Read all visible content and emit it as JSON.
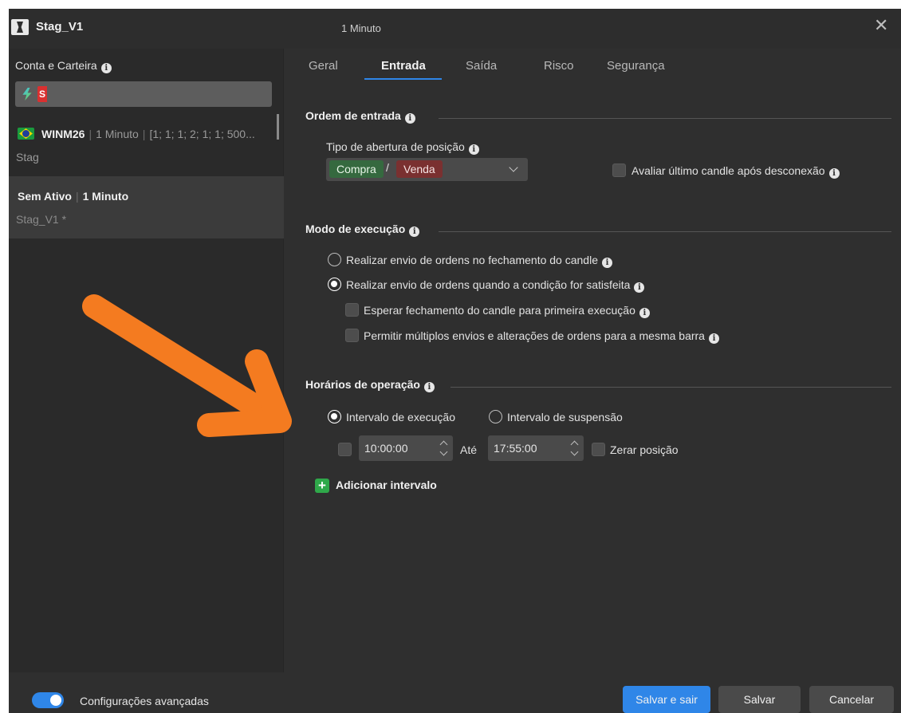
{
  "window": {
    "title": "Stag_V1",
    "subtitle": "1 Minuto",
    "close": "✕"
  },
  "sidebar": {
    "account_label": "Conta e Carteira",
    "strategies": [
      {
        "asset": "WINM26",
        "timeframe": "1 Minuto",
        "params": "[1; 1; 1; 2; 1; 1; 500...",
        "name": "Stag"
      },
      {
        "asset": "Sem Ativo",
        "timeframe": "1 Minuto",
        "name": "Stag_V1 *"
      }
    ]
  },
  "tabs": [
    "Geral",
    "Entrada",
    "Saída",
    "Risco",
    "Segurança"
  ],
  "active_tab": "Entrada",
  "entry": {
    "heading": "Ordem de entrada",
    "position_type_label": "Tipo de abertura de posição",
    "buy_label": "Compra",
    "separator": "/",
    "sell_label": "Venda",
    "reconnect_label": "Avaliar último candle após desconexão"
  },
  "execution": {
    "heading": "Modo de execução",
    "opt_close": "Realizar envio de ordens no fechamento do candle",
    "opt_condition": "Realizar envio de ordens quando a condição for satisfeita",
    "wait_close": "Esperar fechamento do candle para primeira execução",
    "multi_orders": "Permitir múltiplos envios e alterações de ordens para a mesma barra"
  },
  "schedule": {
    "heading": "Horários de operação",
    "exec_interval": "Intervalo de execução",
    "suspend_interval": "Intervalo de suspensão",
    "start": "10:00:00",
    "until": "Até",
    "end": "17:55:00",
    "zero_position": "Zerar posição",
    "add_interval": "Adicionar intervalo"
  },
  "footer": {
    "advanced": "Configurações avançadas",
    "save_exit": "Salvar e sair",
    "save": "Salvar",
    "cancel": "Cancelar"
  },
  "colors": {
    "accent": "#2f86e8",
    "annotation_arrow": "#f47b20",
    "buy": "#35693f",
    "sell": "#7a3030"
  }
}
